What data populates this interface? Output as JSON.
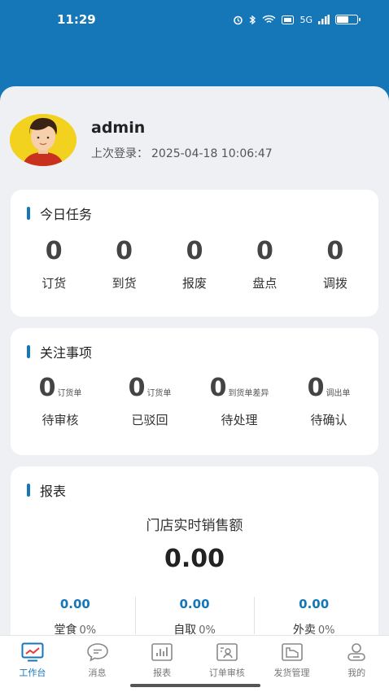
{
  "status": {
    "time": "11:29",
    "signal_label": "5G",
    "battery_percent": 60,
    "accent": "#1576b8"
  },
  "profile": {
    "username": "admin",
    "last_login_label": "上次登录：",
    "last_login_time": "2025-04-18 10:06:47"
  },
  "today_tasks": {
    "title": "今日任务",
    "items": [
      {
        "count": "0",
        "label": "订货"
      },
      {
        "count": "0",
        "label": "到货"
      },
      {
        "count": "0",
        "label": "报废"
      },
      {
        "count": "0",
        "label": "盘点"
      },
      {
        "count": "0",
        "label": "调拨"
      }
    ]
  },
  "attention": {
    "title": "关注事项",
    "items": [
      {
        "count": "0",
        "unit": "订货单",
        "label": "待审核"
      },
      {
        "count": "0",
        "unit": "订货单",
        "label": "已驳回"
      },
      {
        "count": "0",
        "unit": "到货单差异",
        "label": "待处理"
      },
      {
        "count": "0",
        "unit": "调出单",
        "label": "待确认"
      }
    ]
  },
  "report": {
    "title": "报表",
    "subtitle": "门店实时销售额",
    "total": "0.00",
    "columns": [
      {
        "value": "0.00",
        "label": "堂食",
        "percent": "0%"
      },
      {
        "value": "0.00",
        "label": "自取",
        "percent": "0%"
      },
      {
        "value": "0.00",
        "label": "外卖",
        "percent": "0%"
      }
    ]
  },
  "tabs": [
    {
      "label": "工作台",
      "icon": "dashboard-icon",
      "active": true
    },
    {
      "label": "消息",
      "icon": "message-icon",
      "active": false
    },
    {
      "label": "报表",
      "icon": "report-icon",
      "active": false
    },
    {
      "label": "订单审核",
      "icon": "order-review-icon",
      "active": false
    },
    {
      "label": "发货管理",
      "icon": "shipping-icon",
      "active": false
    },
    {
      "label": "我的",
      "icon": "profile-icon",
      "active": false
    }
  ]
}
